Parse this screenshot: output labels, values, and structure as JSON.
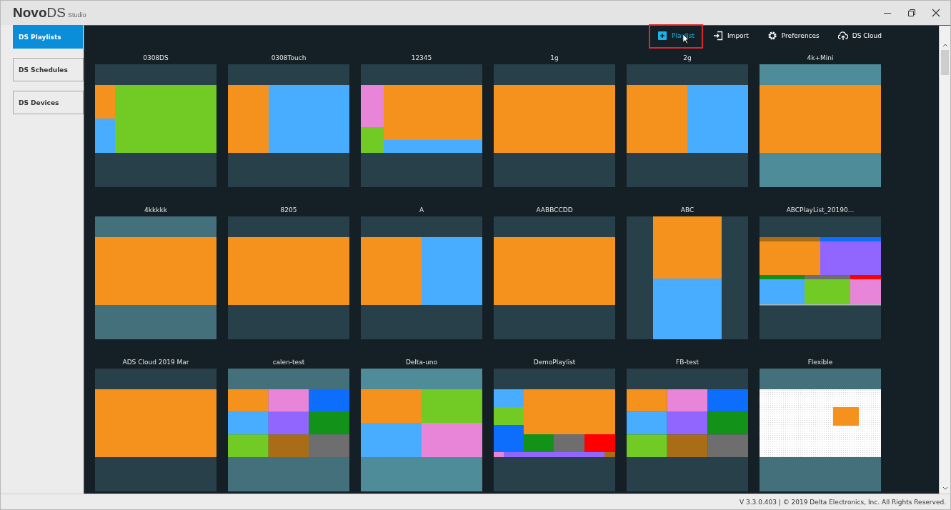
{
  "window": {
    "logo": {
      "brand": "Novo",
      "product": "DS",
      "edition": "Studio"
    }
  },
  "sidebar": {
    "items": [
      {
        "label": "DS Playlists",
        "selected": true
      },
      {
        "label": "DS Schedules",
        "selected": false
      },
      {
        "label": "DS Devices",
        "selected": false
      }
    ]
  },
  "toolbar": [
    {
      "kind": "add",
      "label": "Playlist",
      "hovered": true
    },
    {
      "kind": "import",
      "label": "Import",
      "hovered": false
    },
    {
      "kind": "preferences",
      "label": "Preferences",
      "hovered": false
    },
    {
      "kind": "cloud",
      "label": "DS Cloud",
      "hovered": false
    }
  ],
  "playlists": [
    {
      "name": "0308DS"
    },
    {
      "name": "0308Touch"
    },
    {
      "name": "12345"
    },
    {
      "name": "1g"
    },
    {
      "name": "2g"
    },
    {
      "name": "4k+Mini"
    },
    {
      "name": "4kkkkk"
    },
    {
      "name": "8205"
    },
    {
      "name": "A"
    },
    {
      "name": "AABBCCDD"
    },
    {
      "name": "ABC"
    },
    {
      "name": "ABCPlayList_20190..."
    },
    {
      "name": "ADS Cloud 2019 Mar"
    },
    {
      "name": "calen-test"
    },
    {
      "name": "Delta-uno"
    },
    {
      "name": "DemoPlaylist"
    },
    {
      "name": "FB-test"
    },
    {
      "name": "Flexible"
    }
  ],
  "status_bar": {
    "text": "V 3.3.0.403  |  © 2019 Delta Electronics, Inc. All Rights Reserved."
  }
}
